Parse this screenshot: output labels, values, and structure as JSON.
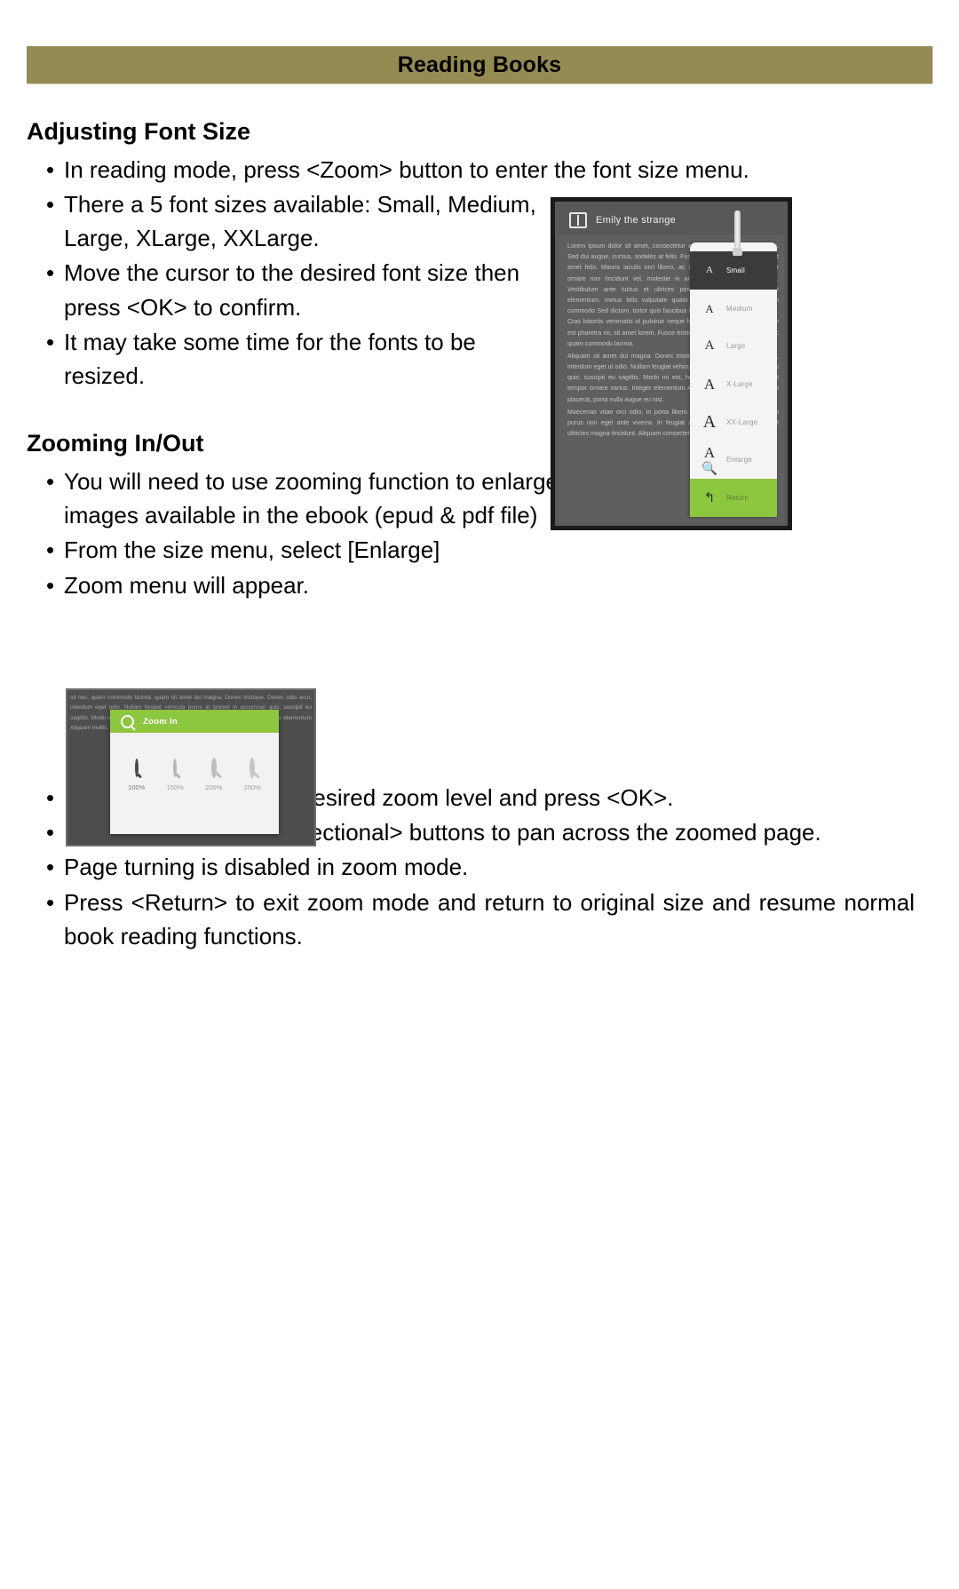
{
  "header": {
    "title": "Reading Books",
    "banner_color": "#948B52"
  },
  "sections": [
    {
      "heading": "Adjusting Font Size",
      "bullets": [
        "In reading mode, press <Zoom> button to enter the font size menu.",
        "There a 5 font sizes available:\nSmall, Medium, Large, XLarge, XXLarge.",
        "Move the cursor to the desired font size then press <OK> to confirm.",
        "It may take some time for the fonts to be resized."
      ]
    },
    {
      "heading": "Zooming In/Out",
      "bullets": [
        "You will need to use zooming function to enlarge images available in the  ebook (epud & pdf file)",
        "From the size menu, select [Enlarge]",
        "Zoom menu will appear."
      ]
    }
  ],
  "bullets_section_one": {
    "b1": "In reading mode, press <Zoom> button to enter the font size menu.",
    "b2_line1": "There a 5 font sizes available:",
    "b2_line2": "Small, Medium, Large, XLarge, XXLarge.",
    "b3_line1": "Move the cursor to the desired font size",
    "b3_line2": "then press <OK> to confirm.",
    "b4_line1": "It may take some time for the fonts to",
    "b4_line2": "be resized."
  },
  "bullets_section_two": {
    "b1_line1": "You will need to use zooming function",
    "b1_line2": "to enlarge images available in the",
    "b1_line3": " ebook (epud & pdf file)",
    "b2": "From the size menu, select [Enlarge]",
    "b3": "Zoom menu will appear."
  },
  "bullets_section_three": {
    "b1": "Move the cursor to the desired zoom level and press <OK>.",
    "b2": "In zoom mode, use <Directional> buttons to pan across the zoomed page.",
    "b3": "Page turning is disabled in zoom mode.",
    "b4": "Press <Return> to exit zoom mode and return to original size and resume normal book reading functions."
  },
  "font_size_menu_screenshot": {
    "book_title": "Emily the strange",
    "book_icon": "open-book-icon",
    "page_text": "Lorem ipsum dolor sit amet, consectetur adipiscing elit, at fringilla tortor. Sed dui augue, cursus, sodales at felis. Fusce a risus laoreet sollicitudin sit amet felis. Mauris iaculis orci libero, ac mollis leo. Sed tempor tempor ornare non tincidunt vel, molestie in arcu. felis ullamcorper ultricies. Vestibulum ante luctus et ultrices posuere cubilia Curae; posuere elementum, metus felis vulputate quam libero sit amet lorem. Etiam commodo Sed dictum, tortor quis faucibus luctus, interdum odio elit ut orci. Cras lobortis venenatis id pulvinar neque lobortis. Sed scelerisque, augue est pharetra mi, sit amet lorem. Fusce tristique elementum nunc ipsum nec quam commodo lacinia.",
    "page_text_2": "Aliquam sit amet dui magna. Donec tristique tristique. Donec odio arcu, interdum eget ut odio. Nullam feugiat vehicula purus at laoreet in accumsan quis, suscipit eu sagittis. Morbi mi est, hendrerit nec lacinia a, volutpat tempor ornare varius. Integer elementum Aliquam mollis, metus eu mollis placerat, porta nulla augue eu nisi.",
    "page_text_3": "Maecenas vitae orci odio, in porta libero. egestas pulvinar. Proin varius purus non eget ante viverra. In feugiat aliquet vestibulum cursus eget ultricies magna tincidunt. Aliquam consectetur vulputate.",
    "menu_items": [
      {
        "icon_glyph": "A",
        "label": "Small",
        "selected": true
      },
      {
        "icon_glyph": "A",
        "label": "Medium",
        "selected": false
      },
      {
        "icon_glyph": "A",
        "label": "Large",
        "selected": false
      },
      {
        "icon_glyph": "A",
        "label": "X-Large",
        "selected": false
      },
      {
        "icon_glyph": "A",
        "label": "XX-Large",
        "selected": false
      },
      {
        "icon_glyph": "A",
        "label": "Enlarge",
        "selected": false
      }
    ],
    "return_item": {
      "icon": "return-arrow-icon",
      "glyph": "↰",
      "label": "Return",
      "color": "#8DC63F"
    }
  },
  "zoom_menu_screenshot": {
    "header_label": "Zoom In",
    "header_icon": "magnifier-icon",
    "header_color": "#8DC63F",
    "background_text": "sit nec, quam commodo lacinia. quam sit amet dui magna. Donec tristique. Donec odio arcu, interdum eget odio. Nullam feugiat vehicula purus at laoreet in accumsan quis, suscipit eu sagittis. Morbi mi est, hendrerit nec lacinia a, volutpat tempor ornare varius. Integer elementum Aliquam mollis, metus eu mollis placerat, porta nulla augue eu nisi.",
    "levels": [
      {
        "percent": "100%",
        "active": true
      },
      {
        "percent": "150%",
        "active": false
      },
      {
        "percent": "200%",
        "active": false
      },
      {
        "percent": "250%",
        "active": false
      }
    ]
  }
}
